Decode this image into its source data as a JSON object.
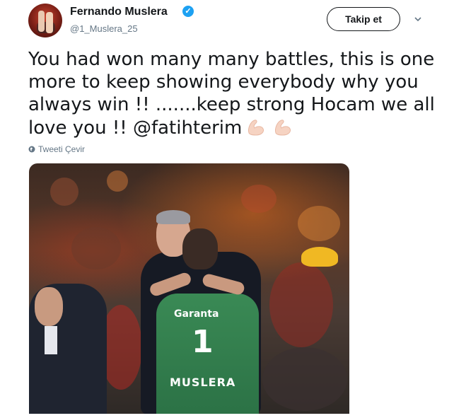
{
  "user": {
    "name": "Fernando Muslera",
    "handle": "@1_Muslera_25",
    "verified": true,
    "avatar_icon": "profile-photo"
  },
  "actions": {
    "follow_label": "Takip et",
    "menu_icon": "chevron-down-icon"
  },
  "tweet": {
    "lines": [
      "You had won many many battles, this is one",
      "more to keep showing everybody why you",
      "always win !! .......keep strong Hocam we all",
      "love you !! "
    ],
    "mention": "@fatihterim",
    "emoji": "flexed-biceps x2",
    "translate_label": "Tweeti Çevir"
  },
  "media": {
    "jersey_sponsor": "Garanta",
    "jersey_number": "1",
    "jersey_name": "MUSLERA"
  },
  "colors": {
    "text": "#14171a",
    "secondary": "#657786",
    "verified": "#1da1f2",
    "keeper_jersey": "#2f7a4b"
  }
}
